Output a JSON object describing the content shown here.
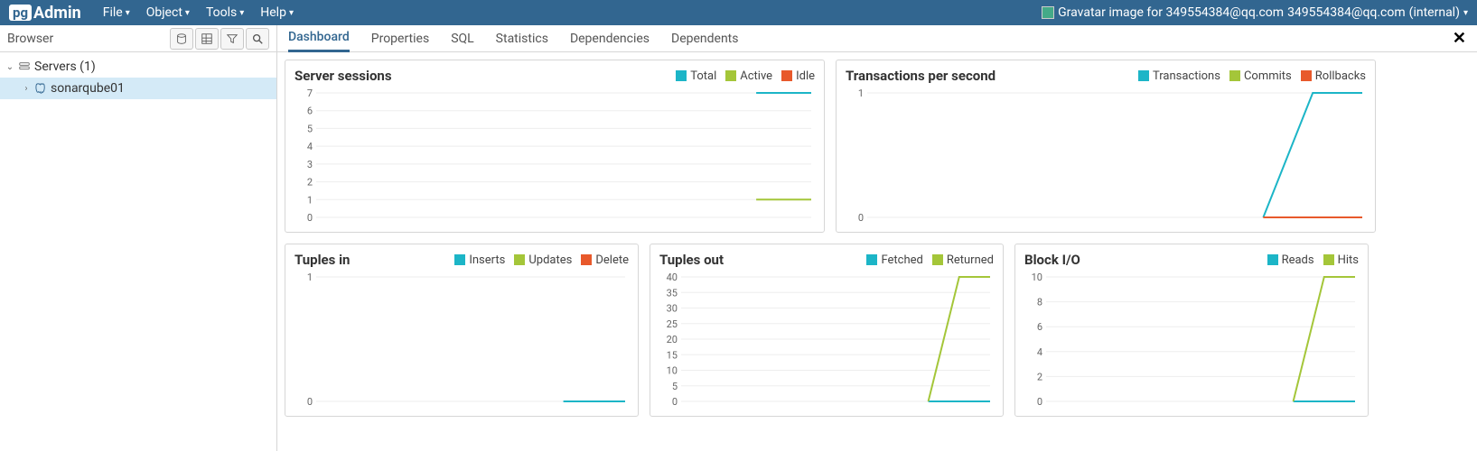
{
  "app": {
    "logo_pg": "pg",
    "logo_admin": "Admin"
  },
  "menu": {
    "file": "File",
    "object": "Object",
    "tools": "Tools",
    "help": "Help"
  },
  "user": {
    "gravatar_alt": "Gravatar image for 349554384@qq.com",
    "email": "349554384@qq.com",
    "suffix": "(internal)"
  },
  "browser": {
    "title": "Browser",
    "tree": {
      "servers_label": "Servers (1)",
      "server1": "sonarqube01"
    }
  },
  "tabs": {
    "dashboard": "Dashboard",
    "properties": "Properties",
    "sql": "SQL",
    "statistics": "Statistics",
    "dependencies": "Dependencies",
    "dependents": "Dependents"
  },
  "colors": {
    "cyan": "#1cb5c7",
    "green": "#a4c639",
    "orange": "#e8592b"
  },
  "panels": {
    "sessions": {
      "title": "Server sessions",
      "legend": {
        "total": "Total",
        "active": "Active",
        "idle": "Idle"
      }
    },
    "tps": {
      "title": "Transactions per second",
      "legend": {
        "transactions": "Transactions",
        "commits": "Commits",
        "rollbacks": "Rollbacks"
      }
    },
    "tuples_in": {
      "title": "Tuples in",
      "legend": {
        "inserts": "Inserts",
        "updates": "Updates",
        "delete": "Delete"
      }
    },
    "tuples_out": {
      "title": "Tuples out",
      "legend": {
        "fetched": "Fetched",
        "returned": "Returned"
      }
    },
    "block_io": {
      "title": "Block I/O",
      "legend": {
        "reads": "Reads",
        "hits": "Hits"
      }
    }
  },
  "chart_data": [
    {
      "id": "sessions",
      "type": "line",
      "ylim": [
        0,
        7
      ],
      "yticks": [
        0,
        1,
        2,
        3,
        4,
        5,
        6,
        7
      ],
      "series": [
        {
          "name": "Total",
          "color": "#1cb5c7",
          "values": [
            null,
            null,
            null,
            null,
            null,
            null,
            null,
            null,
            7,
            7
          ]
        },
        {
          "name": "Active",
          "color": "#a4c639",
          "values": [
            null,
            null,
            null,
            null,
            null,
            null,
            null,
            null,
            1,
            1
          ]
        },
        {
          "name": "Idle",
          "color": "#e8592b",
          "values": [
            null,
            null,
            null,
            null,
            null,
            null,
            null,
            null,
            null,
            null
          ]
        }
      ]
    },
    {
      "id": "tps",
      "type": "line",
      "ylim": [
        0,
        1
      ],
      "yticks": [
        0,
        1
      ],
      "series": [
        {
          "name": "Transactions",
          "color": "#1cb5c7",
          "values": [
            null,
            null,
            null,
            null,
            null,
            null,
            null,
            null,
            0,
            1,
            1
          ]
        },
        {
          "name": "Commits",
          "color": "#a4c639",
          "values": [
            null,
            null,
            null,
            null,
            null,
            null,
            null,
            null,
            0,
            0,
            0
          ]
        },
        {
          "name": "Rollbacks",
          "color": "#e8592b",
          "values": [
            null,
            null,
            null,
            null,
            null,
            null,
            null,
            null,
            0,
            0,
            0
          ]
        }
      ]
    },
    {
      "id": "tuples_in",
      "type": "line",
      "ylim": [
        0,
        1
      ],
      "yticks": [
        0,
        1
      ],
      "series": [
        {
          "name": "Inserts",
          "color": "#1cb5c7",
          "values": [
            null,
            null,
            null,
            null,
            null,
            null,
            null,
            null,
            0,
            0,
            0
          ]
        },
        {
          "name": "Updates",
          "color": "#a4c639",
          "values": [
            null,
            null,
            null,
            null,
            null,
            null,
            null,
            null,
            null,
            null,
            null
          ]
        },
        {
          "name": "Delete",
          "color": "#e8592b",
          "values": [
            null,
            null,
            null,
            null,
            null,
            null,
            null,
            null,
            null,
            null,
            null
          ]
        }
      ]
    },
    {
      "id": "tuples_out",
      "type": "line",
      "ylim": [
        0,
        40
      ],
      "yticks": [
        0,
        5,
        10,
        15,
        20,
        25,
        30,
        35,
        40
      ],
      "series": [
        {
          "name": "Fetched",
          "color": "#1cb5c7",
          "values": [
            null,
            null,
            null,
            null,
            null,
            null,
            null,
            null,
            0,
            0,
            0
          ]
        },
        {
          "name": "Returned",
          "color": "#a4c639",
          "values": [
            null,
            null,
            null,
            null,
            null,
            null,
            null,
            null,
            0,
            40,
            40
          ]
        }
      ]
    },
    {
      "id": "block_io",
      "type": "line",
      "ylim": [
        0,
        10
      ],
      "yticks": [
        0,
        2,
        4,
        6,
        8,
        10
      ],
      "series": [
        {
          "name": "Reads",
          "color": "#1cb5c7",
          "values": [
            null,
            null,
            null,
            null,
            null,
            null,
            null,
            null,
            0,
            0,
            0
          ]
        },
        {
          "name": "Hits",
          "color": "#a4c639",
          "values": [
            null,
            null,
            null,
            null,
            null,
            null,
            null,
            null,
            0,
            10,
            10
          ]
        }
      ]
    }
  ]
}
